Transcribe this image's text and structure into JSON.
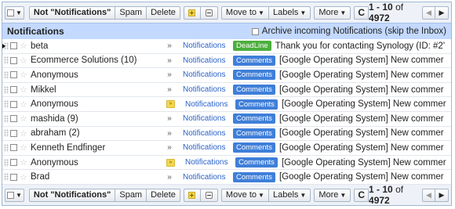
{
  "toolbar": {
    "not_button": "Not \"Notifications\"",
    "spam": "Spam",
    "delete": "Delete",
    "move_to": "Move to",
    "labels": "Labels",
    "more": "More",
    "range": "1 - 10",
    "of_label": "of",
    "total": "4972"
  },
  "header": {
    "title": "Notifications",
    "archive_label": "Archive incoming Notifications (skip the Inbox)"
  },
  "colors": {
    "label_blue": "#3f7fd9",
    "label_green": "#4cae3d"
  },
  "messages": [
    {
      "sender": "beta",
      "important": false,
      "label": "Notifications",
      "badge": "DeadLine",
      "badge_color": "#4cae3d",
      "subject": "Thank you for contacting Synology (ID: #2'",
      "pointer": true
    },
    {
      "sender": "Ecommerce Solutions (10)",
      "important": false,
      "label": "Notifications",
      "badge": "Comments",
      "badge_color": "#3f7fd9",
      "subject": "[Google Operating System] New commer",
      "pointer": false
    },
    {
      "sender": "Anonymous",
      "important": false,
      "label": "Notifications",
      "badge": "Comments",
      "badge_color": "#3f7fd9",
      "subject": "[Google Operating System] New commer",
      "pointer": false
    },
    {
      "sender": "Mikkel",
      "important": false,
      "label": "Notifications",
      "badge": "Comments",
      "badge_color": "#3f7fd9",
      "subject": "[Google Operating System] New commer",
      "pointer": false
    },
    {
      "sender": "Anonymous",
      "important": true,
      "label": "Notifications",
      "badge": "Comments",
      "badge_color": "#3f7fd9",
      "subject": "[Google Operating System] New commer",
      "pointer": false
    },
    {
      "sender": "mashida (9)",
      "important": false,
      "label": "Notifications",
      "badge": "Comments",
      "badge_color": "#3f7fd9",
      "subject": "[Google Operating System] New commer",
      "pointer": false
    },
    {
      "sender": "abraham (2)",
      "important": false,
      "label": "Notifications",
      "badge": "Comments",
      "badge_color": "#3f7fd9",
      "subject": "[Google Operating System] New commer",
      "pointer": false
    },
    {
      "sender": "Kenneth Endfinger",
      "important": false,
      "label": "Notifications",
      "badge": "Comments",
      "badge_color": "#3f7fd9",
      "subject": "[Google Operating System] New commer",
      "pointer": false
    },
    {
      "sender": "Anonymous",
      "important": true,
      "label": "Notifications",
      "badge": "Comments",
      "badge_color": "#3f7fd9",
      "subject": "[Google Operating System] New commer",
      "pointer": false
    },
    {
      "sender": "Brad",
      "important": false,
      "label": "Notifications",
      "badge": "Comments",
      "badge_color": "#3f7fd9",
      "subject": "[Google Operating System] New commer",
      "pointer": false
    }
  ]
}
